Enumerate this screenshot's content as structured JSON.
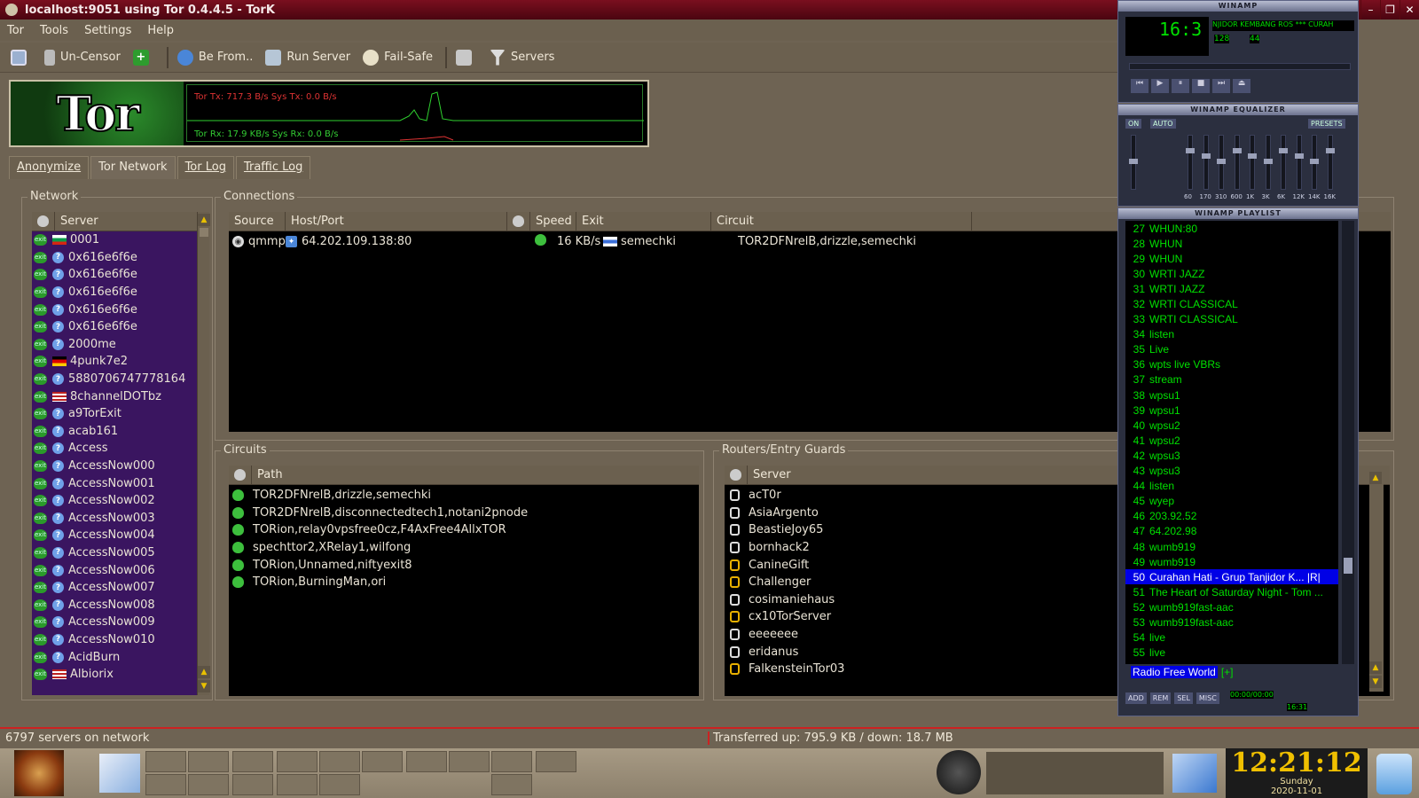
{
  "window": {
    "title": "localhost:9051 using Tor 0.4.4.5 - TorK"
  },
  "menu": [
    "Tor",
    "Tools",
    "Settings",
    "Help"
  ],
  "toolbar": {
    "uncensor": "Un-Censor",
    "be_from": "Be From..",
    "run_server": "Run Server",
    "fail_safe": "Fail-Safe",
    "servers": "Servers"
  },
  "banner": {
    "logo": "Tor",
    "tx": "Tor Tx: 717.3 B/s  Sys Tx: 0.0 B/s",
    "rx": "Tor Rx: 17.9 KB/s  Sys Rx: 0.0 B/s"
  },
  "tabs": [
    "Anonymize",
    "Tor Network",
    "Tor Log",
    "Traffic Log"
  ],
  "network": {
    "title": "Network",
    "col": "Server",
    "servers": [
      {
        "name": "0001",
        "flag": "bg"
      },
      {
        "name": "0x616e6f6e",
        "flag": "q"
      },
      {
        "name": "0x616e6f6e",
        "flag": "q"
      },
      {
        "name": "0x616e6f6e",
        "flag": "q"
      },
      {
        "name": "0x616e6f6e",
        "flag": "q"
      },
      {
        "name": "0x616e6f6e",
        "flag": "q"
      },
      {
        "name": "2000me",
        "flag": "q"
      },
      {
        "name": "4punk7e2",
        "flag": "de"
      },
      {
        "name": "5880706747778164",
        "flag": "q"
      },
      {
        "name": "8channelDOTbz",
        "flag": "us"
      },
      {
        "name": "a9TorExit",
        "flag": "q"
      },
      {
        "name": "acab161",
        "flag": "q"
      },
      {
        "name": "Access",
        "flag": "q"
      },
      {
        "name": "AccessNow000",
        "flag": "q"
      },
      {
        "name": "AccessNow001",
        "flag": "q"
      },
      {
        "name": "AccessNow002",
        "flag": "q"
      },
      {
        "name": "AccessNow003",
        "flag": "q"
      },
      {
        "name": "AccessNow004",
        "flag": "q"
      },
      {
        "name": "AccessNow005",
        "flag": "q"
      },
      {
        "name": "AccessNow006",
        "flag": "q"
      },
      {
        "name": "AccessNow007",
        "flag": "q"
      },
      {
        "name": "AccessNow008",
        "flag": "q"
      },
      {
        "name": "AccessNow009",
        "flag": "q"
      },
      {
        "name": "AccessNow010",
        "flag": "q"
      },
      {
        "name": "AcidBurn",
        "flag": "q"
      },
      {
        "name": "Albiorix",
        "flag": "us"
      }
    ]
  },
  "connections": {
    "title": "Connections",
    "cols": [
      "Source",
      "Host/Port",
      "Speed",
      "Exit",
      "Circuit"
    ],
    "rows": [
      {
        "source": "qmmp",
        "host": "64.202.109.138:80",
        "speed": "16 KB/s",
        "exit": "semechki",
        "circuit": "TOR2DFNrelB,drizzle,semechki"
      }
    ]
  },
  "circuits": {
    "title": "Circuits",
    "col": "Path",
    "rows": [
      "TOR2DFNrelB,drizzle,semechki",
      "TOR2DFNrelB,disconnectedtech1,notani2pnode",
      "TORion,relay0vpsfree0cz,F4AxFree4AllxTOR",
      "spechttor2,XRelay1,wilfong",
      "TORion,Unnamed,niftyexit8",
      "TORion,BurningMan,ori"
    ]
  },
  "routers": {
    "title": "Routers/Entry Guards",
    "col": "Server",
    "rows": [
      {
        "name": "acT0r",
        "gold": false
      },
      {
        "name": "AsiaArgento",
        "gold": false
      },
      {
        "name": "BeastieJoy65",
        "gold": false
      },
      {
        "name": "bornhack2",
        "gold": false
      },
      {
        "name": "CanineGift",
        "gold": true
      },
      {
        "name": "Challenger",
        "gold": true
      },
      {
        "name": "cosimaniehaus",
        "gold": false
      },
      {
        "name": "cx10TorServer",
        "gold": true
      },
      {
        "name": "eeeeeee",
        "gold": false
      },
      {
        "name": "eridanus",
        "gold": false
      },
      {
        "name": "FalkensteinTor03",
        "gold": true
      }
    ]
  },
  "status": {
    "left": "6797 servers on network",
    "right": "Transferred up: 795.9 KB / down: 18.7 MB"
  },
  "winamp": {
    "title": "WINAMP",
    "time": "16:3",
    "track": "NJIDOR KEMBANG ROS *** CURAH",
    "kbps": "128",
    "khz": "44",
    "eq_title": "WINAMP EQUALIZER",
    "eq_on": "ON",
    "eq_auto": "AUTO",
    "eq_presets": "PRESETS",
    "eq_bands": [
      "60",
      "170",
      "310",
      "600",
      "1K",
      "3K",
      "6K",
      "12K",
      "14K",
      "16K"
    ],
    "playlist_title": "WINAMP PLAYLIST",
    "playlist": [
      {
        "n": "27",
        "t": "WHUN:80"
      },
      {
        "n": "28",
        "t": "WHUN"
      },
      {
        "n": "29",
        "t": "WHUN"
      },
      {
        "n": "30",
        "t": "WRTI JAZZ"
      },
      {
        "n": "31",
        "t": "WRTI JAZZ"
      },
      {
        "n": "32",
        "t": "WRTI CLASSICAL"
      },
      {
        "n": "33",
        "t": "WRTI CLASSICAL"
      },
      {
        "n": "34",
        "t": "listen"
      },
      {
        "n": "35",
        "t": "Live"
      },
      {
        "n": "36",
        "t": "wpts live VBRs"
      },
      {
        "n": "37",
        "t": "stream"
      },
      {
        "n": "38",
        "t": "wpsu1"
      },
      {
        "n": "39",
        "t": "wpsu1"
      },
      {
        "n": "40",
        "t": "wpsu2"
      },
      {
        "n": "41",
        "t": "wpsu2"
      },
      {
        "n": "42",
        "t": "wpsu3"
      },
      {
        "n": "43",
        "t": "wpsu3"
      },
      {
        "n": "44",
        "t": "listen"
      },
      {
        "n": "45",
        "t": "wyep"
      },
      {
        "n": "46",
        "t": "203.92.52"
      },
      {
        "n": "47",
        "t": "64.202.98"
      },
      {
        "n": "48",
        "t": "wumb919"
      },
      {
        "n": "49",
        "t": "wumb919"
      },
      {
        "n": "50",
        "t": "Curahan Hati - Grup Tanjidor K... |R|"
      },
      {
        "n": "51",
        "t": "The Heart of Saturday Night - Tom ..."
      },
      {
        "n": "52",
        "t": "wumb919fast-aac"
      },
      {
        "n": "53",
        "t": "wumb919fast-aac"
      },
      {
        "n": "54",
        "t": "live"
      },
      {
        "n": "55",
        "t": "live"
      }
    ],
    "selected": "50",
    "footer": "Radio Free World",
    "footer_plus": "[+]",
    "pl_buttons": [
      "ADD",
      "REM",
      "SEL",
      "MISC"
    ],
    "pl_time": "00:00/00:00",
    "pl_time2": "16:31"
  },
  "clock": {
    "time": "12:21:12",
    "day": "Sunday",
    "date": "2020-11-01"
  }
}
